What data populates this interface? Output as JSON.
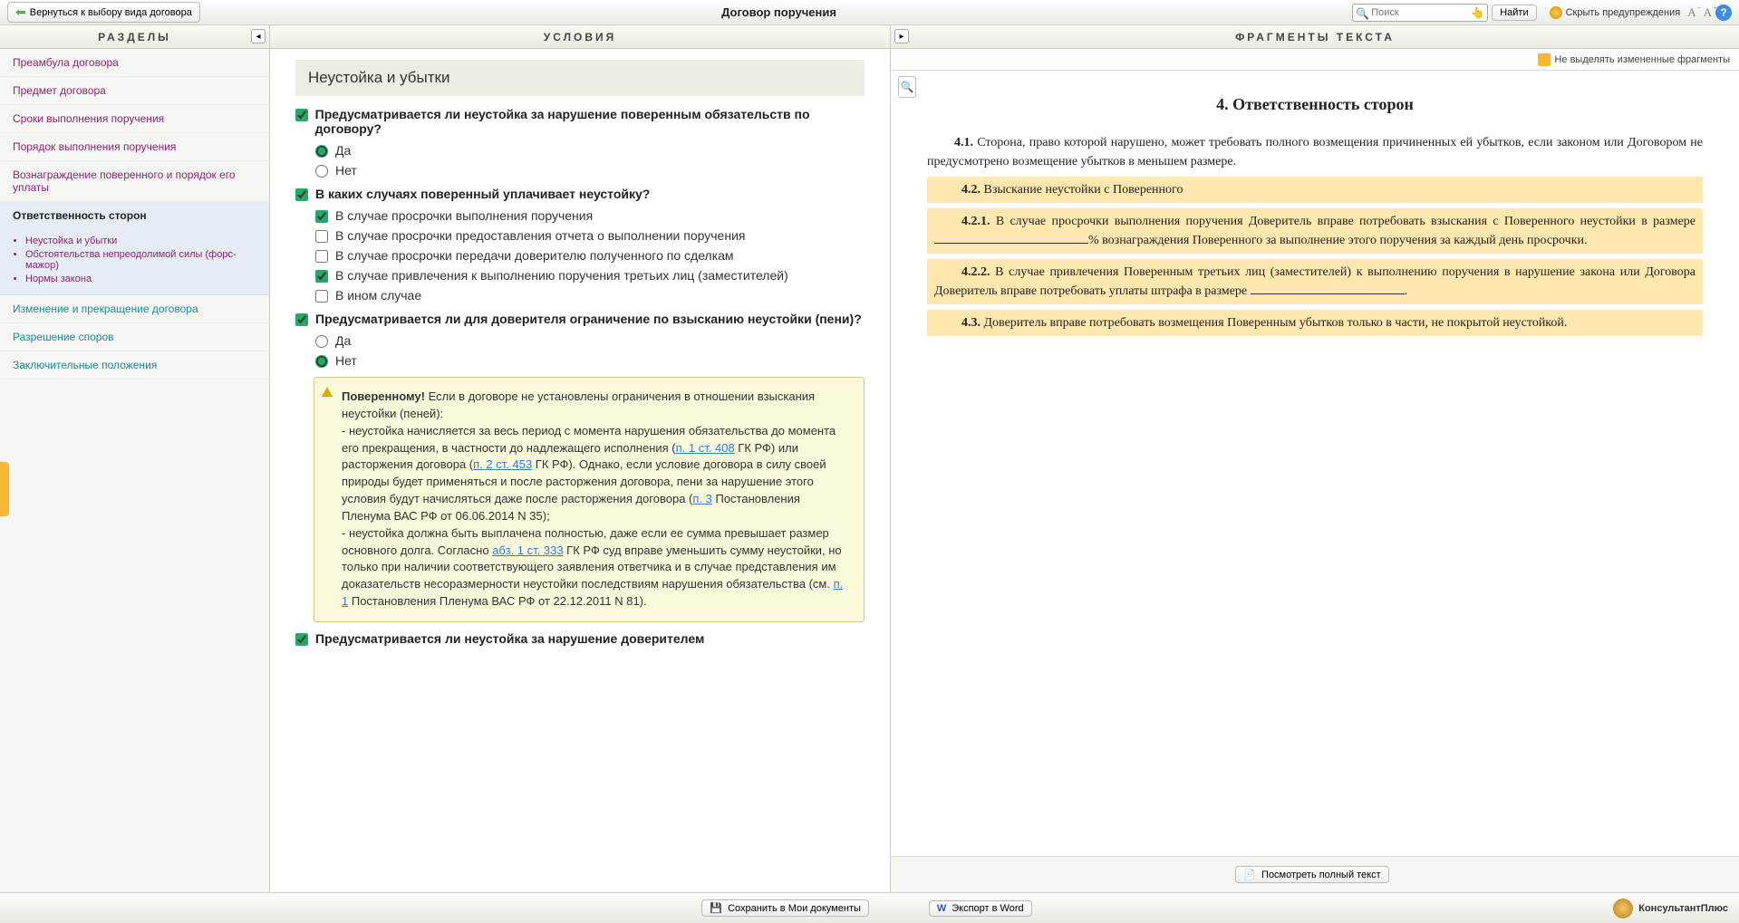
{
  "topbar": {
    "back": "Вернуться к выбору вида договора",
    "title": "Договор поручения",
    "search_placeholder": "Поиск",
    "find": "Найти",
    "hide_warnings": "Скрыть предупреждения"
  },
  "columns": {
    "sections": "РАЗДЕЛЫ",
    "conditions": "УСЛОВИЯ",
    "fragments": "ФРАГМЕНТЫ ТЕКСТА"
  },
  "sidebar": {
    "items": [
      "Преамбула договора",
      "Предмет договора",
      "Сроки выполнения поручения",
      "Порядок выполнения поручения",
      "Вознаграждение поверенного и порядок его уплаты"
    ],
    "active": "Ответственность сторон",
    "sub": [
      "Неустойка и убытки",
      "Обстоятельства непреодолимой силы (форс-мажор)",
      "Нормы закона"
    ],
    "after": [
      "Изменение и прекращение договора",
      "Разрешение споров",
      "Заключительные положения"
    ]
  },
  "conditions": {
    "section_title": "Неустойка и убытки",
    "q1": {
      "text": "Предусматривается ли неустойка за нарушение поверенным обязательств по договору?",
      "yes": "Да",
      "no": "Нет"
    },
    "q2": {
      "text": "В каких случаях поверенный уплачивает неустойку?",
      "o1": "В случае просрочки выполнения поручения",
      "o2": "В случае просрочки предоставления отчета о выполнении поручения",
      "o3": "В случае просрочки передачи доверителю полученного по сделкам",
      "o4": "В случае привлечения к выполнению поручения третьих лиц (заместителей)",
      "o5": "В ином случае"
    },
    "q3": {
      "text": "Предусматривается ли для доверителя ограничение по взысканию неустойки (пени)?",
      "yes": "Да",
      "no": "Нет"
    },
    "warning": {
      "lead_bold": "Поверенному!",
      "lead_rest": " Если в договоре не установлены ограничения в отношении взыскания неустойки (пеней):",
      "p1a": "- неустойка начисляется за весь период с момента нарушения обязательства до момента его прекращения, в частности до надлежащего исполнения (",
      "link1": "п. 1 ст. 408",
      "p1b": " ГК РФ) или расторжения договора (",
      "link2": "п. 2 ст. 453",
      "p1c": " ГК РФ). Однако, если условие договора в силу своей природы будет применяться и после расторжения договора, пени за нарушение этого условия будут начисляться даже после расторжения договора (",
      "link3": "п. 3",
      "p1d": " Постановления Пленума ВАС РФ от 06.06.2014 N 35);",
      "p2a": "- неустойка должна быть выплачена полностью, даже если ее сумма превышает размер основного долга. Согласно ",
      "link4": "абз. 1 ст. 333",
      "p2b": " ГК РФ суд вправе уменьшить сумму неустойки, но только при наличии соответствующего заявления ответчика и в случае представления им доказательств несоразмерности неустойки последствиям нарушения обязательства (см. ",
      "link5": "п. 1",
      "p2c": " Постановления Пленума ВАС РФ от 22.12.2011 N 81)."
    },
    "q4": "Предусматривается ли неустойка за нарушение доверителем"
  },
  "fragments": {
    "no_highlight": "Не выделять измененные фрагменты",
    "heading": "4. Ответственность сторон",
    "p41_num": "4.1.",
    "p41": " Сторона, право которой нарушено, может требовать полного возмещения причиненных ей убытков, если законом или Договором не предусмотрено возмещение убытков в меньшем размере.",
    "p42_num": "4.2.",
    "p42": " Взыскание неустойки с Поверенного",
    "p421_num": "4.2.1.",
    "p421a": " В случае просрочки выполнения поручения Доверитель вправе потребовать взыскания с Поверенного неустойки в размере ",
    "p421b": "% вознаграждения Поверенного за выполнение этого поручения за каждый день просрочки.",
    "p422_num": "4.2.2.",
    "p422a": " В случае привлечения Поверенным третьих лиц (заместителей) к выполнению поручения в нарушение закона или Договора Доверитель вправе потребовать уплаты штрафа в размере ",
    "p422b": ".",
    "p43_num": "4.3.",
    "p43": " Доверитель вправе потребовать возмещения Поверенным убытков только в части, не покрытой неустойкой.",
    "full_text": "Посмотреть полный текст"
  },
  "bottom": {
    "save": "Сохранить в Мои документы",
    "export": "Экспорт в Word",
    "brand": "КонсультантПлюс"
  }
}
